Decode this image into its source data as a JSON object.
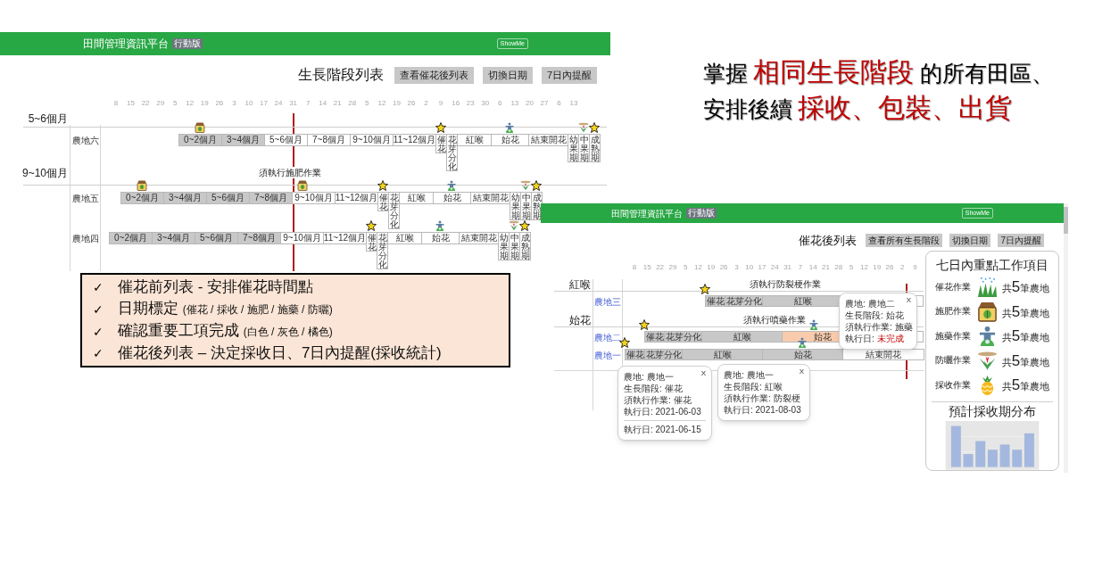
{
  "screens": [
    {
      "kind": "stage_list",
      "header": {
        "title": "田間管理資訊平台",
        "badge": "行動版",
        "button": "ShowMe"
      },
      "page_title": "生長階段列表",
      "buttons": [
        "查看催花後列表",
        "切換日期",
        "7日內提醒"
      ],
      "ticks": [
        "8",
        "15",
        "22",
        "29",
        "5",
        "12",
        "19",
        "26",
        "3",
        "10",
        "17",
        "24",
        "31",
        "7",
        "14",
        "21",
        "28",
        "5",
        "12",
        "19",
        "26",
        "2",
        "9",
        "16",
        "23",
        "30",
        "6",
        "13",
        "20",
        "27",
        "6",
        "13"
      ],
      "groups": [
        {
          "label": "5~6個月",
          "rows": [
            {
              "label": "農地六",
              "segments": [
                {
                  "label": "0~2個月",
                  "color": "#c8c8c8"
                },
                {
                  "label": "3~4個月",
                  "color": "#c8c8c8"
                },
                {
                  "label": "5~6個月",
                  "color": "#ffffff"
                },
                {
                  "label": "7~8個月",
                  "color": "#ffffff"
                },
                {
                  "label": "9~10個月",
                  "color": "#ffffff"
                },
                {
                  "label": "11~12個月",
                  "color": "#ffffff"
                },
                {
                  "label": "催花",
                  "color": "#ffffff"
                },
                {
                  "label": "花芽分化",
                  "color": "#ffffff"
                },
                {
                  "label": "紅喉",
                  "color": "#ffffff"
                },
                {
                  "label": "始花",
                  "color": "#ffffff"
                },
                {
                  "label": "結束開花",
                  "color": "#ffffff"
                },
                {
                  "label": "幼果期",
                  "color": "#ffffff"
                },
                {
                  "label": "中果期",
                  "color": "#ffffff"
                },
                {
                  "label": "成熟期",
                  "color": "#ffffff"
                }
              ]
            }
          ]
        },
        {
          "label": "9~10個月",
          "task": "須執行施肥作業",
          "rows": [
            {
              "label": "農地五",
              "segments": [
                {
                  "label": "0~2個月",
                  "color": "#c8c8c8"
                },
                {
                  "label": "3~4個月",
                  "color": "#c8c8c8"
                },
                {
                  "label": "5~6個月",
                  "color": "#c8c8c8"
                },
                {
                  "label": "7~8個月",
                  "color": "#c8c8c8"
                },
                {
                  "label": "9~10個月",
                  "color": "#ffffff"
                },
                {
                  "label": "11~12個月",
                  "color": "#ffffff"
                },
                {
                  "label": "催花",
                  "color": "#ffffff"
                },
                {
                  "label": "花芽分化",
                  "color": "#ffffff"
                },
                {
                  "label": "紅喉",
                  "color": "#ffffff"
                },
                {
                  "label": "始花",
                  "color": "#ffffff"
                },
                {
                  "label": "結束開花",
                  "color": "#ffffff"
                },
                {
                  "label": "幼果期",
                  "color": "#ffffff"
                },
                {
                  "label": "中果期",
                  "color": "#ffffff"
                },
                {
                  "label": "成熟期",
                  "color": "#ffffff"
                }
              ]
            },
            {
              "label": "農地四",
              "segments": [
                {
                  "label": "0~2個月",
                  "color": "#c8c8c8"
                },
                {
                  "label": "3~4個月",
                  "color": "#c8c8c8"
                },
                {
                  "label": "5~6個月",
                  "color": "#c8c8c8"
                },
                {
                  "label": "7~8個月",
                  "color": "#c8c8c8"
                },
                {
                  "label": "9~10個月",
                  "color": "#ffffff"
                },
                {
                  "label": "11~12個月",
                  "color": "#ffffff"
                },
                {
                  "label": "催花",
                  "color": "#ffffff"
                },
                {
                  "label": "花芽分化",
                  "color": "#ffffff"
                },
                {
                  "label": "紅喉",
                  "color": "#ffffff"
                },
                {
                  "label": "始花",
                  "color": "#ffffff"
                },
                {
                  "label": "結束開花",
                  "color": "#ffffff"
                },
                {
                  "label": "幼果期",
                  "color": "#ffffff"
                },
                {
                  "label": "中果期",
                  "color": "#ffffff"
                },
                {
                  "label": "成熟期",
                  "color": "#ffffff"
                }
              ]
            }
          ]
        }
      ]
    },
    {
      "kind": "post_forcing_list",
      "header": {
        "title": "田間管理資訊平台",
        "badge": "行動版",
        "button": "ShowMe"
      },
      "page_title": "催花後列表",
      "buttons": [
        "查看所有生長階段",
        "切換日期",
        "7日內提醒"
      ],
      "ticks": [
        "8",
        "15",
        "22",
        "29",
        "5",
        "12",
        "19",
        "26",
        "3",
        "10",
        "17",
        "24",
        "31",
        "7",
        "14",
        "21",
        "28",
        "5",
        "12",
        "19",
        "26",
        "2",
        "9"
      ],
      "groups": [
        {
          "label": "紅喉",
          "task": "須執行防裂梗作業",
          "rows": [
            {
              "label": "農地三",
              "segments": [
                {
                  "label": "催花",
                  "color": "#c8c8c8"
                },
                {
                  "label": "花芽分化",
                  "color": "#c8c8c8"
                },
                {
                  "label": "紅喉",
                  "color": "#c8c8c8"
                }
              ]
            }
          ]
        },
        {
          "label": "始花",
          "task": "須執行噴藥作業",
          "rows": [
            {
              "label": "農地二",
              "segments": [
                {
                  "label": "催花",
                  "color": "#c8c8c8"
                },
                {
                  "label": "花芽分化",
                  "color": "#c8c8c8"
                },
                {
                  "label": "紅喉",
                  "color": "#c8c8c8"
                },
                {
                  "label": "始花",
                  "color": "#f8cbad"
                }
              ]
            },
            {
              "label": "農地一",
              "segments": [
                {
                  "label": "催花",
                  "color": "#c8c8c8"
                },
                {
                  "label": "花芽分化",
                  "color": "#c8c8c8"
                },
                {
                  "label": "紅喉",
                  "color": "#c8c8c8"
                },
                {
                  "label": "始花",
                  "color": "#c8c8c8"
                },
                {
                  "label": "結束開花",
                  "color": "#ffffff"
                }
              ]
            }
          ]
        }
      ],
      "popups": [
        {
          "close": "X",
          "lines": [
            {
              "label": "農地: ",
              "value": "農地一",
              "alert": false
            },
            {
              "label": "生長階段: ",
              "value": "催花",
              "alert": false
            },
            {
              "label": "須執行作業: ",
              "value": "催花",
              "alert": false
            },
            {
              "label": "執行日: ",
              "value": "2021-06-03",
              "alert": false
            }
          ],
          "extra_lines": [
            {
              "label": "執行日: ",
              "value": "2021-06-15",
              "alert": false
            }
          ]
        },
        {
          "close": "X",
          "lines": [
            {
              "label": "農地: ",
              "value": "農地一",
              "alert": false
            },
            {
              "label": "生長階段: ",
              "value": "紅喉",
              "alert": false
            },
            {
              "label": "須執行作業: ",
              "value": "防裂梗",
              "alert": false
            },
            {
              "label": "執行日: ",
              "value": "2021-08-03",
              "alert": false
            }
          ]
        },
        {
          "close": "X",
          "lines": [
            {
              "label": "農地: ",
              "value": "農地二",
              "alert": false
            },
            {
              "label": "生長階段: ",
              "value": "始花",
              "alert": false
            },
            {
              "label": "須執行作業: ",
              "value": "施藥",
              "alert": false
            },
            {
              "label": "執行日: ",
              "value": "未完成",
              "alert": true
            }
          ]
        }
      ],
      "summary": {
        "title": "七日內重點工作項目",
        "tasks": [
          {
            "label": "催花作業",
            "count": "共**5**筆農地"
          },
          {
            "label": "施肥作業",
            "count": "共**5**筆農地"
          },
          {
            "label": "施藥作業",
            "count": "共**5**筆農地"
          },
          {
            "label": "防曬作業",
            "count": "共**5**筆農地"
          },
          {
            "label": "採收作業",
            "count": "共**5**筆農地"
          }
        ],
        "chart_title": "預計採收期分布"
      }
    }
  ],
  "headline": [
    [
      {
        "text": "掌握 ",
        "highlight": false
      },
      {
        "text": "相同生長階段",
        "highlight": true
      },
      {
        "text": " 的所有田區、",
        "highlight": false
      }
    ],
    [
      {
        "text": "安排後續 ",
        "highlight": false
      },
      {
        "text": "採收、包裝、出貨",
        "highlight": true
      }
    ]
  ],
  "checklist": [
    {
      "mark": "✓",
      "parts": [
        {
          "text": "催花前列表 - 安排催花時間點",
          "small": false
        }
      ]
    },
    {
      "mark": "✓",
      "parts": [
        {
          "text": "日期標定 ",
          "small": false
        },
        {
          "text": "(催花 / 採收 / 施肥 / 施藥 / 防曬)",
          "small": true
        }
      ]
    },
    {
      "mark": "✓",
      "parts": [
        {
          "text": "確認重要工項完成 ",
          "small": false
        },
        {
          "text": "(白色 / 灰色 / 橘色)",
          "small": true
        }
      ]
    },
    {
      "mark": "✓",
      "parts": [
        {
          "text": "催花後列表 – 決定採收日、7日內提醒(採收統計)",
          "small": false
        }
      ]
    }
  ]
}
